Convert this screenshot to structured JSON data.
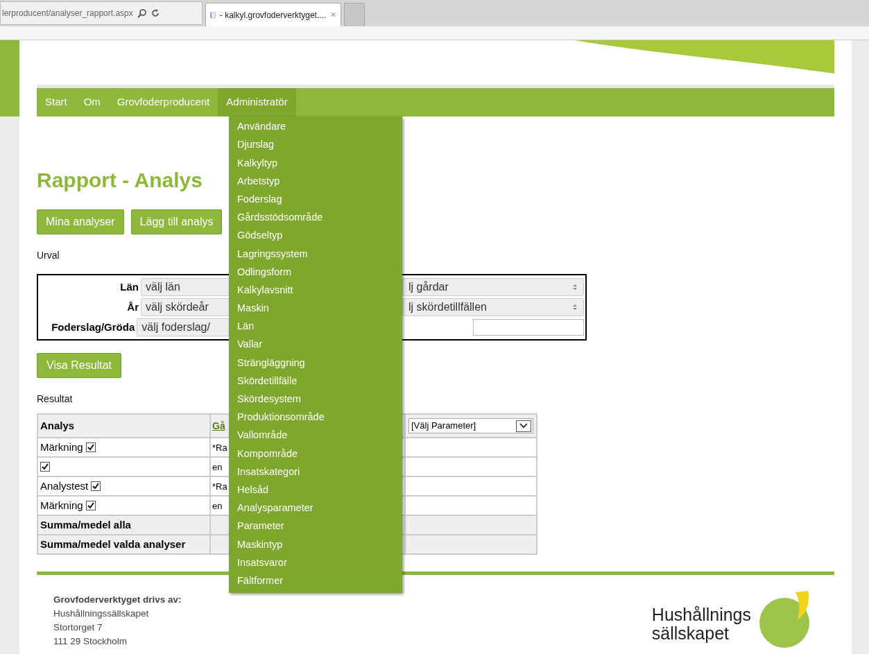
{
  "browser": {
    "address": "lerproducent/analyser_rapport.aspx",
    "tab_title": "- kalkyl.grovfoderverktyget....",
    "tab_close": "×"
  },
  "nav": [
    {
      "label": "Start",
      "selected": false
    },
    {
      "label": "Om",
      "selected": false
    },
    {
      "label": "Grovfoderproducent",
      "selected": false
    },
    {
      "label": "Administratör",
      "selected": true
    }
  ],
  "menu": [
    "Användare",
    "Djurslag",
    "Kalkyltyp",
    "Arbetstyp",
    "Foderslag",
    "Gårdsstödsområde",
    "Gödseltyp",
    "Lagringssystem",
    "Odlingsform",
    "Kalkylavsnitt",
    "Maskin",
    "Län",
    "Vallar",
    "Strängläggning",
    "Skördetillfälle",
    "Skördesystem",
    "Produktionsområde",
    "Vallområde",
    "Kompområde",
    "Insatskategori",
    "Helsåd",
    "Analysparameter",
    "Parameter",
    "Maskintyp",
    "Insatsvaror",
    "Fältformer"
  ],
  "title": "Rapport - Analys",
  "buttons": [
    "Mina analyser",
    "Lägg till analys"
  ],
  "urval_label": "Urval",
  "filters": [
    {
      "label": "Län",
      "left": "välj län",
      "right": "lj gårdar",
      "kind": "select"
    },
    {
      "label": "År",
      "left": "välj skördeår",
      "right": "lj skördetillfällen",
      "kind": "select"
    },
    {
      "label": "Foderslag/Gröda",
      "left": "välj foderslag/",
      "kind": "input"
    }
  ],
  "show_button": "Visa Resultat",
  "result_label": "Resultat",
  "table": {
    "header": {
      "analys": "Analys",
      "column_2": "Gå",
      "parameter": "[Välj Parameter]"
    },
    "rows": [
      {
        "name": "Märkning",
        "checked": true,
        "column_2": "*Ra"
      },
      {
        "name": "",
        "checked": true,
        "column_2": "en"
      },
      {
        "name": "Analystest",
        "checked": true,
        "column_2": "*Ra"
      },
      {
        "name": "Märkning",
        "checked": true,
        "column_2": "en"
      }
    ],
    "sums": [
      "Summa/medel alla",
      "Summa/medel valda analyser"
    ]
  },
  "footer": {
    "heading": "Grovfoderverktyget drivs av:",
    "lines": [
      "Hushållningssällskapet",
      "Stortorget 7",
      "111 29 Stockholm"
    ],
    "logo_lines": [
      "Hushållnings",
      "sällskapet"
    ]
  }
}
